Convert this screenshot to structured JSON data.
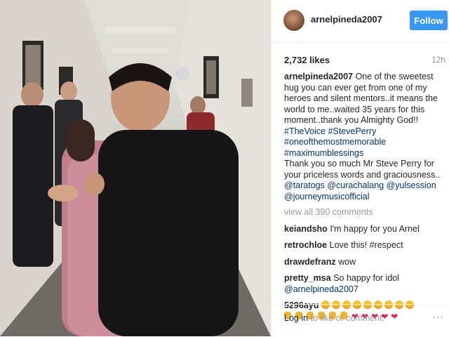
{
  "header": {
    "username": "arnelpineda2007",
    "follow_label": "Follow"
  },
  "post": {
    "likes": "2,732 likes",
    "time": "12h",
    "caption_user": "arnelpineda2007",
    "caption_lines": [
      "One of the sweetest",
      "hug you can ever get from one of my",
      "heroes and silent mentors..it means the",
      "world to me..waited 35 years for this",
      "moment..thank you Almighty God!!"
    ],
    "hashtags": [
      "#TheVoice #StevePerry",
      "#oneofthemostmemorable",
      "#maximumblessings"
    ],
    "thanks_lines": [
      "Thank you so much Mr Steve Perry for",
      "your priceless words and graciousness.."
    ],
    "mentions": [
      "@taratogs @curachalang @yulsession",
      "@journeymusicofficial"
    ]
  },
  "view_all": "view all 390 comments",
  "comments": [
    {
      "user": "keiandsho",
      "text": "I'm happy for you Arnel"
    },
    {
      "user": "retrochloe",
      "text": "Love this! #respect"
    },
    {
      "user": "drawdefranz",
      "text": "wow"
    },
    {
      "user": "pretty_msa",
      "text": "So happy for idol",
      "mention": "@arnelpineda2007"
    },
    {
      "user": "5296ayu",
      "text": ""
    }
  ],
  "footer": {
    "login_link": "Log in",
    "login_rest": "to like or comment.",
    "more": "..."
  },
  "colors": {
    "accent": "#3897f0",
    "link": "#003569",
    "muted": "#999999"
  }
}
